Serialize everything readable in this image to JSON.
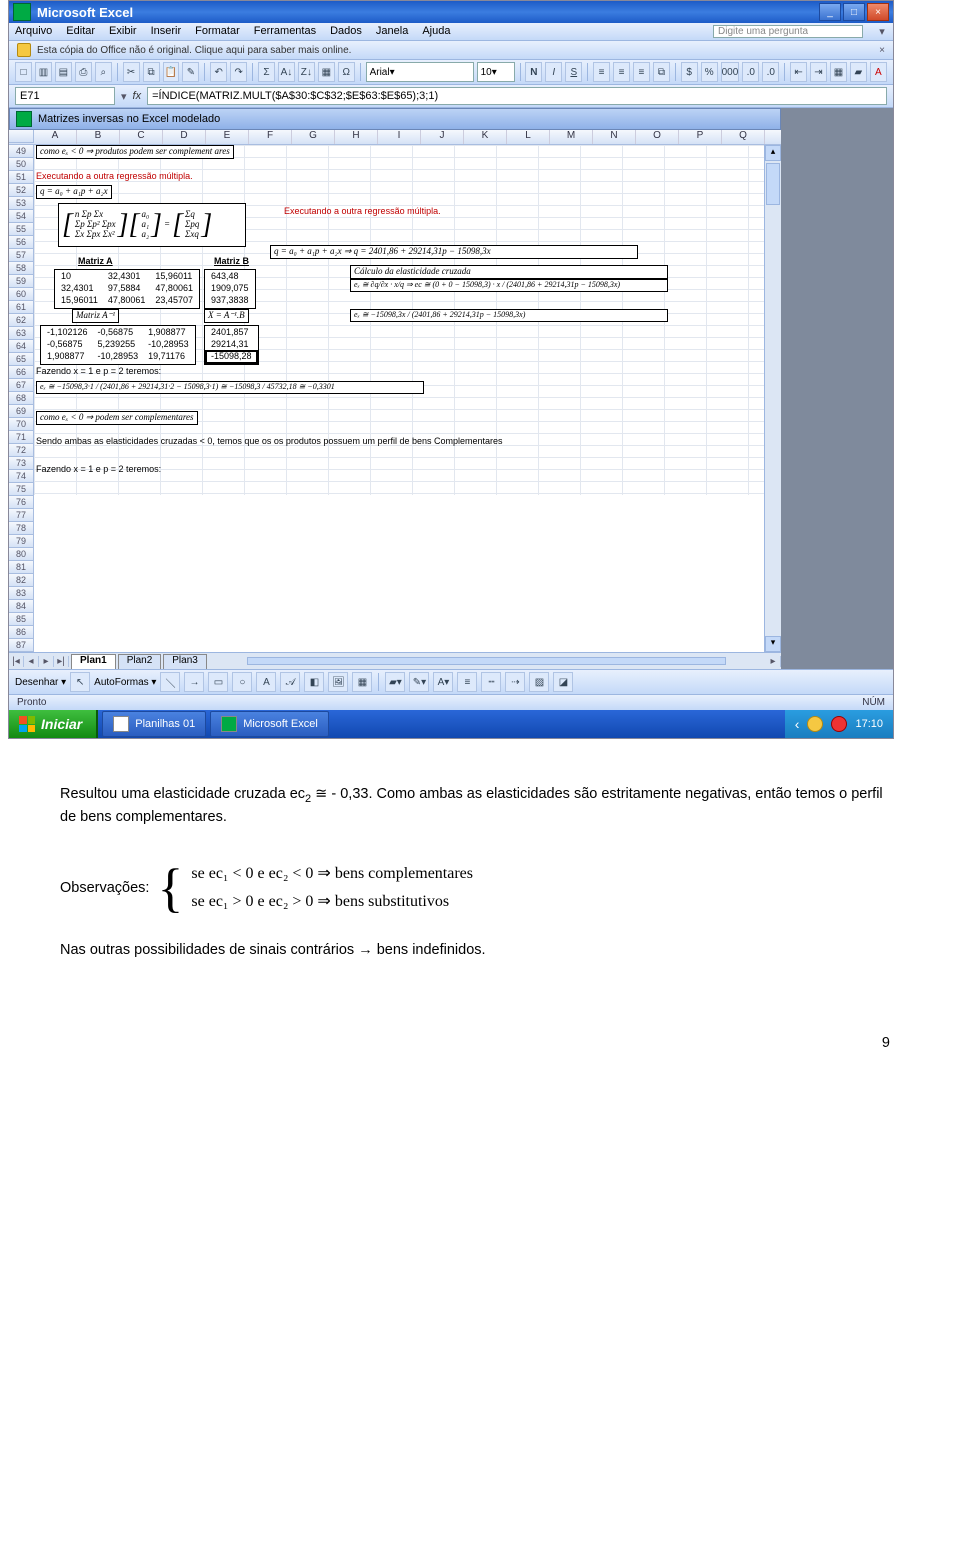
{
  "titlebar": {
    "app": "Microsoft Excel"
  },
  "menu": {
    "items": [
      "Arquivo",
      "Editar",
      "Exibir",
      "Inserir",
      "Formatar",
      "Ferramentas",
      "Dados",
      "Janela",
      "Ajuda"
    ],
    "ask": "Digite uma pergunta"
  },
  "infobar": {
    "text": "Esta cópia do Office não é original. Clique aqui para saber mais online."
  },
  "font": {
    "name": "Arial",
    "size": "10"
  },
  "name_box": {
    "cell": "E71"
  },
  "formula_bar": {
    "fx": "fx",
    "value": "=ÍNDICE(MATRIZ.MULT($A$30:$C$32;$E$63:$E$65);3;1)"
  },
  "doc_window": {
    "title": "Matrizes inversas no Excel modelado"
  },
  "columns": [
    "A",
    "B",
    "C",
    "D",
    "E",
    "F",
    "G",
    "H",
    "I",
    "J",
    "K",
    "L",
    "M",
    "N",
    "O",
    "P",
    "Q"
  ],
  "rows_start": 49,
  "rows_end": 87,
  "overlay": {
    "r49": "como eₓ < 0 ⇒ produtos  podem  ser  complement ares",
    "r52": "Executando a outra regressão múltipla.",
    "r53_eq": "q = a₀ + a₁p + a₂x",
    "matrix_hdr": "Matriz A",
    "matrix_b_hdr": "Matriz B",
    "matrix_a_inv": "Matriz  A⁻¹",
    "x_ab": "X = A⁻¹.B",
    "ma": [
      [
        "n",
        "Σp",
        "Σx"
      ],
      [
        "a₀",
        "",
        "Σq"
      ],
      [
        "Σp",
        "Σp²",
        "Σpx"
      ],
      [
        "a₁",
        "=",
        "Σpq"
      ],
      [
        "Σx",
        "Σpx",
        "Σx²"
      ],
      [
        "a₂",
        "",
        "Σxq"
      ]
    ],
    "nums_a": [
      [
        "10",
        "32,4301",
        "15,96011"
      ],
      [
        "32,4301",
        "97,5884",
        "47,80061"
      ],
      [
        "15,96011",
        "47,80061",
        "23,45707"
      ]
    ],
    "nums_b": [
      [
        "643,48"
      ],
      [
        "1909,075"
      ],
      [
        "937,3838"
      ]
    ],
    "nums_ainv": [
      [
        "-1,102126",
        "-0,56875",
        "1,908877"
      ],
      [
        "-0,56875",
        "5,239255",
        "-10,28953"
      ],
      [
        "1,908877",
        "-10,28953",
        "19,71176"
      ]
    ],
    "nums_x": [
      [
        "2401,857"
      ],
      [
        "29214,31"
      ],
      [
        "-15098,28"
      ]
    ],
    "reg2": "Executando a outra regressão múltipla.",
    "eq61": "q = a₀ + a₁p + a₂x ⇒ q = 2401,86 + 29214,31p − 15098,3x",
    "calc_hdr": "Cálculo da elasticidade cruzada",
    "ec_line1": "eₓ ≅ ∂q/∂x · x/q ⇒ ec ≅ (0 + 0 − 15098,3) · x / (2401,86 + 29214,31p − 15098,3x)",
    "ec_line2": "eₓ ≅ −15098,3x / (2401,86 + 29214,31p − 15098,3x)",
    "r73": "Fazendo x = 1 e p = 2 teremos:",
    "ec_calc": "eₓ ≅ −15098,3·1 / (2401,86 + 29214,31·2 − 15098,3·1) ≅ −15098,3 / 45732,18 ≅ −0,3301",
    "r78": "como eₓ < 0 ⇒ podem  ser complementares",
    "r81": "Sendo ambas as elasticidades cruzadas < 0, temos que os os produtos possuem um perfil de bens Complementares",
    "r81_word": "Complementares",
    "r84": "Fazendo x = 1 e p = 2 teremos:"
  },
  "sheet_tabs": {
    "tabs": [
      "Plan1",
      "Plan2",
      "Plan3"
    ],
    "active": 0
  },
  "drawbar": {
    "label": "Desenhar",
    "autoshapes": "AutoFormas"
  },
  "statusbar": {
    "left": "Pronto",
    "right": "NÚM"
  },
  "taskbar": {
    "start": "Iniciar",
    "items": [
      "Planilhas 01",
      "Microsoft Excel"
    ],
    "time": "17:10"
  },
  "doc": {
    "p1a": "Resultou uma elasticidade cruzada ec",
    "p1sub": "2",
    "p1b": " ≅ - 0,33. Como ambas as elasticidades são estritamente negativas, então temos o perfil de bens complementares.",
    "obs_label": "Observações:",
    "math1": "se ec₁ < 0  e  ec₂ < 0 ⇒ bens complementares",
    "math2": "se ec₁ > 0  e  ec₂ > 0 ⇒ bens substitutivos",
    "p2": "Nas outras possibilidades de sinais contrários → bens indefinidos.",
    "pagenum": "9"
  }
}
